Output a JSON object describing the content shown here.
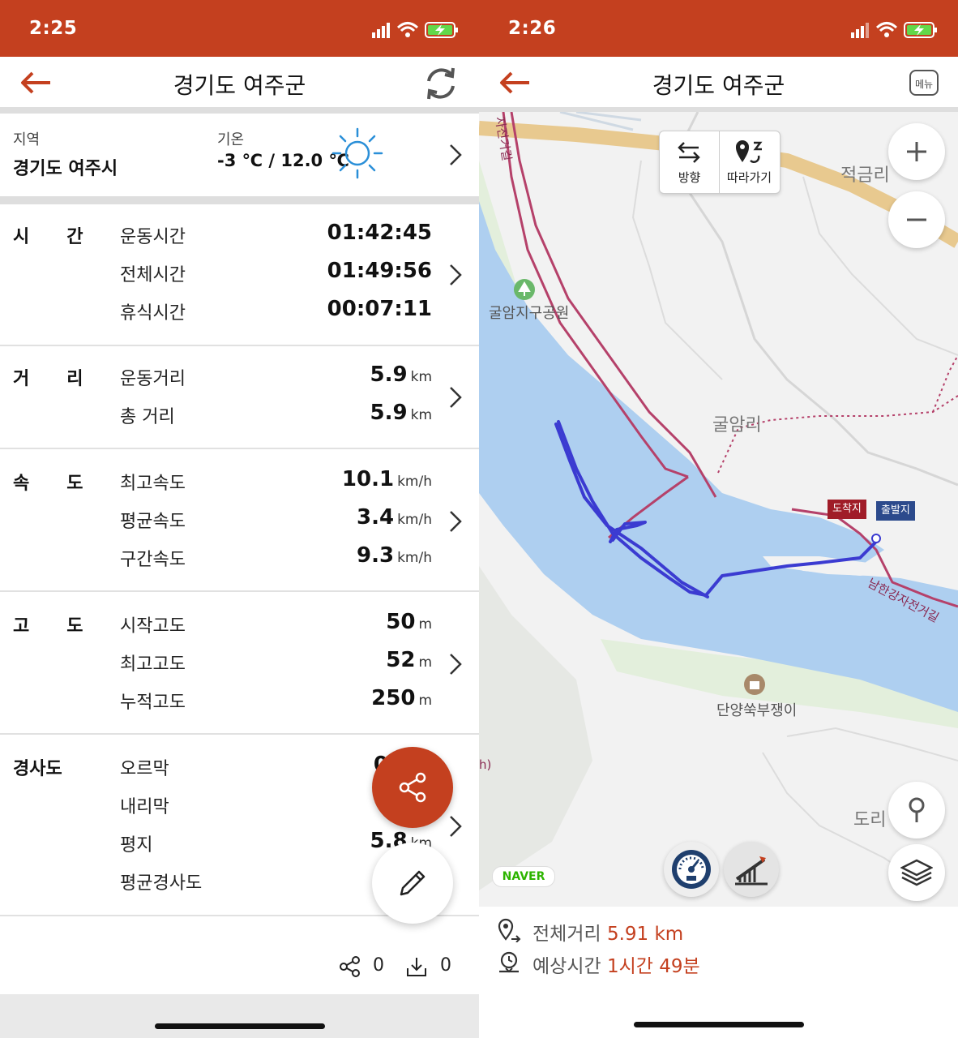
{
  "left": {
    "status": {
      "time": "2:25"
    },
    "nav": {
      "title": "경기도 여주군"
    },
    "region": {
      "label": "지역",
      "value": "경기도 여주시",
      "temp_label": "기온",
      "temp_value": "-3 ℃ / 12.0 ℃"
    },
    "sections": {
      "time": {
        "label": "시 간",
        "rows": [
          {
            "label": "운동시간",
            "value": "01:42:45",
            "unit": ""
          },
          {
            "label": "전체시간",
            "value": "01:49:56",
            "unit": ""
          },
          {
            "label": "휴식시간",
            "value": "00:07:11",
            "unit": ""
          }
        ]
      },
      "distance": {
        "label": "거 리",
        "rows": [
          {
            "label": "운동거리",
            "value": "5.9",
            "unit": "km"
          },
          {
            "label": "총 거리",
            "value": "5.9",
            "unit": "km"
          }
        ]
      },
      "speed": {
        "label": "속 도",
        "rows": [
          {
            "label": "최고속도",
            "value": "10.1",
            "unit": "km/h"
          },
          {
            "label": "평균속도",
            "value": "3.4",
            "unit": "km/h"
          },
          {
            "label": "구간속도",
            "value": "9.3",
            "unit": "km/h"
          }
        ]
      },
      "altitude": {
        "label": "고 도",
        "rows": [
          {
            "label": "시작고도",
            "value": "50",
            "unit": "m"
          },
          {
            "label": "최고고도",
            "value": "52",
            "unit": "m"
          },
          {
            "label": "누적고도",
            "value": "250",
            "unit": "m"
          }
        ]
      },
      "slope": {
        "label": "경사도",
        "rows": [
          {
            "label": "오르막",
            "value": "0",
            "unit": ""
          },
          {
            "label": "내리막",
            "value": "",
            "unit": ""
          },
          {
            "label": "평지",
            "value": "5.8",
            "unit": "km"
          },
          {
            "label": "평균경사도",
            "value": "",
            "unit": ""
          }
        ]
      }
    },
    "bottom": {
      "share_count": "0",
      "download_count": "0"
    }
  },
  "right": {
    "status": {
      "time": "2:26"
    },
    "nav": {
      "title": "경기도 여주군",
      "menu_label": "메뉴"
    },
    "map": {
      "direction_label": "방향",
      "follow_label": "따라가기",
      "labels": {
        "park": "굴암지구공원",
        "village": "굴암리",
        "north_village": "적금리",
        "south_poi": "단양쑥부쟁이",
        "east_village": "도리",
        "bike_road_south": "남한강자전거길",
        "bike_road_north": "자전거길",
        "edge_char": "h)"
      },
      "flag_arrival": "도착지",
      "flag_start": "출발지",
      "naver_logo": "NAVER"
    },
    "summary": {
      "total_distance_label": "전체거리",
      "total_distance_value": "5.91 km",
      "est_time_label": "예상시간",
      "est_time_value": "1시간 49분"
    }
  },
  "colors": {
    "brand": "#c4401f",
    "route": "#3b3bd1",
    "river": "#aecff0",
    "bike_road": "#b5416a"
  }
}
